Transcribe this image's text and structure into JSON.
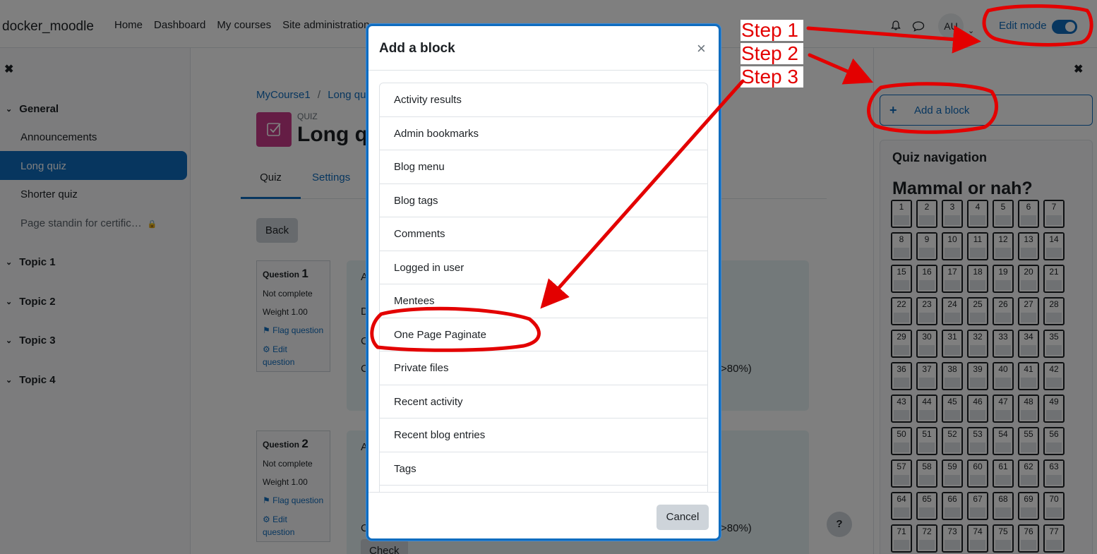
{
  "navbar": {
    "brand": "docker_moodle",
    "links": [
      "Home",
      "Dashboard",
      "My courses",
      "Site administration"
    ],
    "avatar_initials": "AU",
    "edit_mode_label": "Edit mode",
    "edit_mode_on": true
  },
  "left_drawer": {
    "sections": [
      {
        "title": "General",
        "activities": [
          {
            "label": "Announcements"
          },
          {
            "label": "Long quiz",
            "active": true
          },
          {
            "label": "Shorter quiz"
          },
          {
            "label": "Page standin for certific…",
            "locked": true
          }
        ]
      },
      {
        "title": "Topic 1"
      },
      {
        "title": "Topic 2"
      },
      {
        "title": "Topic 3"
      },
      {
        "title": "Topic 4"
      }
    ]
  },
  "main": {
    "breadcrumb": [
      "MyCourse1",
      "/",
      "Long qui"
    ],
    "activity_type": "QUIZ",
    "title": "Long q",
    "tabs": [
      "Quiz",
      "Settings"
    ],
    "back_label": "Back",
    "questions": [
      {
        "label": "Question",
        "number": "1",
        "state": "Not complete",
        "weight": "Weight 1.00",
        "flag": "Flag question",
        "edit": "Edit",
        "edit2": "question"
      },
      {
        "label": "Question",
        "number": "2",
        "state": "Not complete",
        "weight": "Weight 1.00",
        "flag": "Flag question",
        "edit": "Edit",
        "edit2": "question"
      }
    ],
    "q1_fragments": [
      "A",
      "D",
      "C",
      "C",
      ">80%)"
    ],
    "q2_fragments": [
      "A",
      "C",
      ">80%)",
      "Check"
    ]
  },
  "right_drawer": {
    "add_block_label": "Add a block",
    "quiz_nav_title": "Quiz navigation",
    "quiz_name": "Mammal or nah?",
    "question_numbers": [
      "1",
      "2",
      "3",
      "4",
      "5",
      "6",
      "7",
      "8",
      "9",
      "10",
      "11",
      "12",
      "13",
      "14",
      "15",
      "16",
      "17",
      "18",
      "19",
      "20",
      "21",
      "22",
      "23",
      "24",
      "25",
      "26",
      "27",
      "28",
      "29",
      "30",
      "31",
      "32",
      "33",
      "34",
      "35",
      "36",
      "37",
      "38",
      "39",
      "40",
      "41",
      "42",
      "43",
      "44",
      "45",
      "46",
      "47",
      "48",
      "49",
      "50",
      "51",
      "52",
      "53",
      "54",
      "55",
      "56",
      "57",
      "58",
      "59",
      "60",
      "61",
      "62",
      "63",
      "64",
      "65",
      "66",
      "67",
      "68",
      "69",
      "70",
      "71",
      "72",
      "73",
      "74",
      "75",
      "76",
      "77"
    ]
  },
  "modal": {
    "title": "Add a block",
    "close_glyph": "×",
    "blocks": [
      "Activity results",
      "Admin bookmarks",
      "Blog menu",
      "Blog tags",
      "Comments",
      "Logged in user",
      "Mentees",
      "One Page Paginate",
      "Private files",
      "Recent activity",
      "Recent blog entries",
      "Tags"
    ],
    "cancel_label": "Cancel"
  },
  "help_glyph": "?",
  "annotations": {
    "steps": [
      "Step 1",
      "Step 2",
      "Step 3"
    ],
    "color": "#e30000"
  },
  "colors": {
    "primary": "#0f6cbf",
    "quiz_icon": "#ca3b8a"
  }
}
